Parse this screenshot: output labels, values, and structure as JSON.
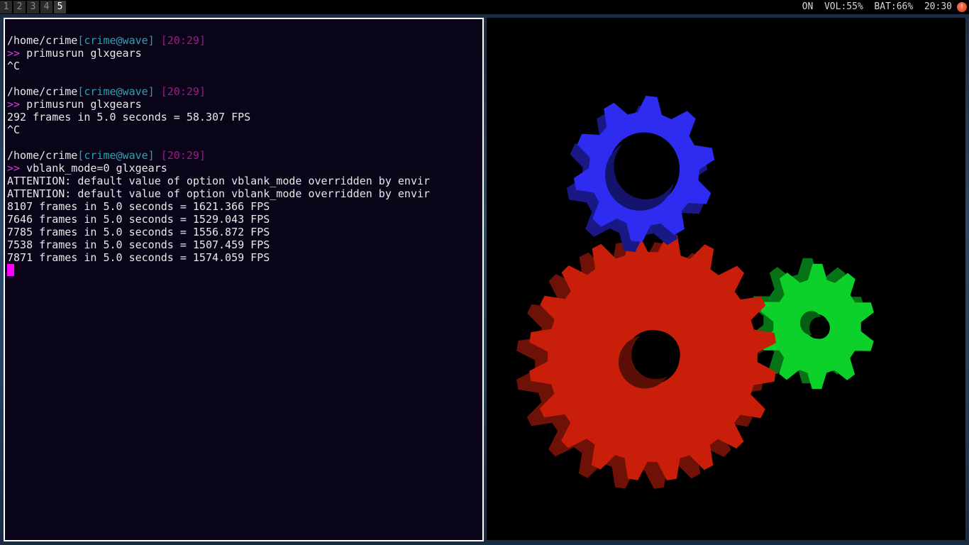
{
  "workspaces": [
    "1",
    "2",
    "3",
    "4",
    "5"
  ],
  "active_workspace": "5",
  "status_bar": {
    "text": "ON  VOL:55%  BAT:66%  20:30",
    "tray_icon": "alert-icon",
    "tray_glyph": "!"
  },
  "terminal": {
    "blocks": [
      {
        "path": "/home/crime",
        "user_host": "[crime@wave]",
        "time": "[20:29]",
        "prompt": ">>",
        "command": " primusrun glxgears",
        "output": [
          "^C"
        ]
      },
      {
        "path": "/home/crime",
        "user_host": "[crime@wave]",
        "time": "[20:29]",
        "prompt": ">>",
        "command": " primusrun glxgears",
        "output": [
          "292 frames in 5.0 seconds = 58.307 FPS",
          "^C"
        ]
      },
      {
        "path": "/home/crime",
        "user_host": "[crime@wave]",
        "time": "[20:29]",
        "prompt": ">>",
        "command": " vblank_mode=0 glxgears",
        "output": [
          "ATTENTION: default value of option vblank_mode overridden by envir",
          "ATTENTION: default value of option vblank_mode overridden by envir",
          "8107 frames in 5.0 seconds = 1621.366 FPS",
          "7646 frames in 5.0 seconds = 1529.043 FPS",
          "7785 frames in 5.0 seconds = 1556.872 FPS",
          "7538 frames in 5.0 seconds = 1507.459 FPS",
          "7871 frames in 5.0 seconds = 1574.059 FPS"
        ]
      }
    ],
    "cursor_color": "#ff00ff"
  },
  "colors": {
    "terminal_bg": "#0a0418",
    "user_host": "#2aa1b3",
    "time": "#a3178a",
    "prompt": "#d33cd3",
    "gear_red": "#c81e0a",
    "gear_green": "#0bd12a",
    "gear_blue": "#2d2cf0"
  },
  "gears": [
    {
      "name": "blue-gear",
      "color": "#2d2cf0",
      "teeth": 10
    },
    {
      "name": "red-gear",
      "color": "#c81e0a",
      "teeth": 20
    },
    {
      "name": "green-gear",
      "color": "#0bd12a",
      "teeth": 10
    }
  ]
}
